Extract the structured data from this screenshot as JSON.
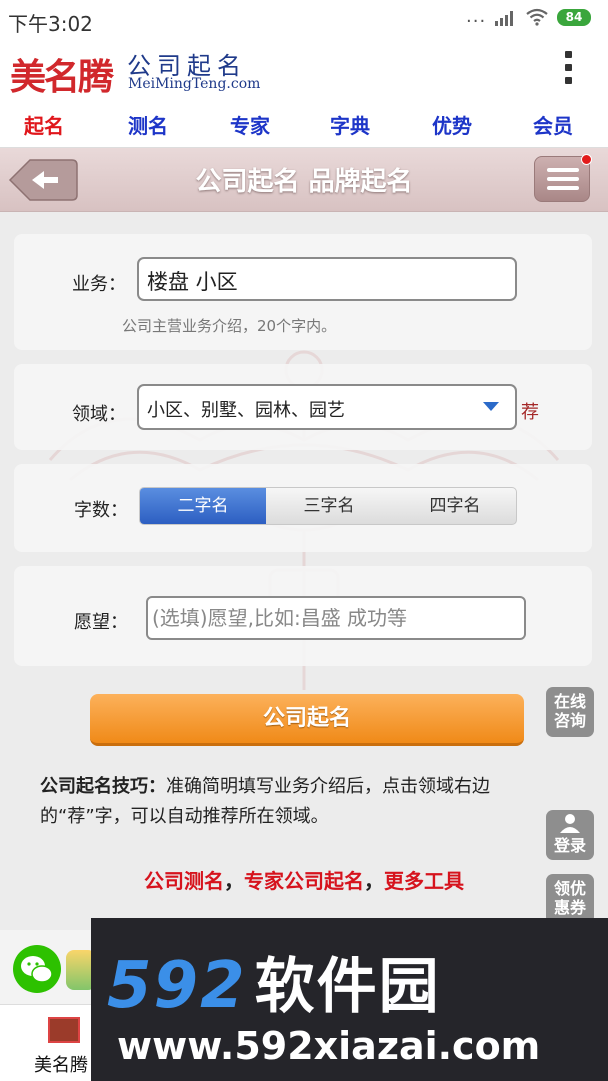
{
  "status_bar": {
    "time": "下午3:02",
    "dots": "...",
    "battery": "84"
  },
  "brand": {
    "logo_cn": "美名腾",
    "subtitle_cn": "公司起名",
    "subtitle_en": "MeiMingTeng.com"
  },
  "nav": {
    "items": [
      "起名",
      "测名",
      "专家",
      "字典",
      "优势",
      "会员"
    ],
    "active_index": 0
  },
  "page": {
    "title": "公司起名 品牌起名"
  },
  "form": {
    "business": {
      "label": "业务：",
      "value": "楼盘 小区",
      "hint": "公司主营业务介绍，20个字内。"
    },
    "domain": {
      "label": "领域：",
      "value": "小区、别墅、园林、园艺",
      "recommend": "荐"
    },
    "char_count": {
      "label": "字数：",
      "options": [
        "二字名",
        "三字名",
        "四字名"
      ],
      "selected_index": 0
    },
    "wish": {
      "label": "愿望：",
      "placeholder": "(选填)愿望,比如:昌盛 成功等"
    },
    "submit_label": "公司起名"
  },
  "side_buttons": {
    "consult": "在线咨询",
    "login": "登录",
    "coupon": "领优惠券"
  },
  "tips": {
    "title": "公司起名技巧：",
    "body": "准确简明填写业务介绍后，点击领域右边的“荐”字，可以自动推荐所在领域。"
  },
  "links": {
    "items": [
      "公司测名",
      "专家公司起名",
      "更多工具"
    ],
    "separator": "，"
  },
  "bottom_tab": {
    "label": "美名腾"
  },
  "watermark": {
    "big_num": "592",
    "big_cn": "软件园",
    "url": "www.592xiazai.com"
  },
  "colors": {
    "brand_red": "#d1282c",
    "nav_blue": "#1d35c8",
    "submit_orange": "#f08a18",
    "watermark_blue": "#3b8fe8"
  }
}
